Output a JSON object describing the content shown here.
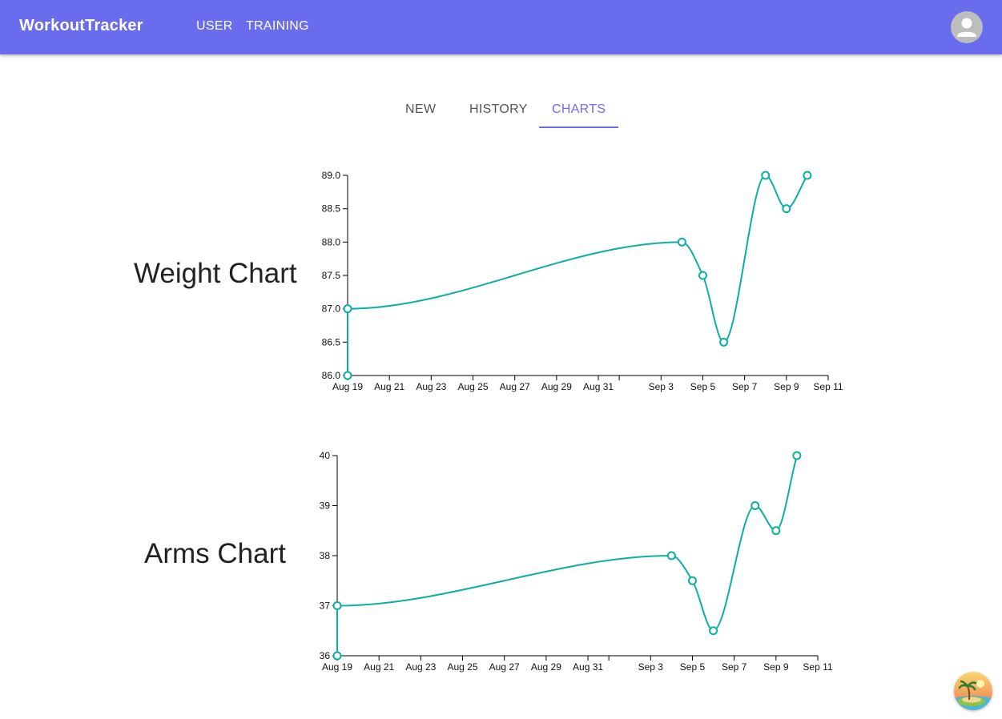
{
  "app": {
    "brand": "WorkoutTracker",
    "nav": {
      "user": "USER",
      "training": "TRAINING"
    }
  },
  "tabs": {
    "new": "NEW",
    "history": "HISTORY",
    "charts": "CHARTS",
    "active": "CHARTS"
  },
  "colors": {
    "appbar": "#6a6cee",
    "accent": "#6a6cee",
    "line": "#0aaea4"
  },
  "icons": {
    "avatar": "account-circle-icon",
    "fab": "tropical-island-logo-icon"
  },
  "charts": [
    {
      "title": "Weight Chart",
      "chart_data": {
        "type": "line",
        "curve": "smooth",
        "xlabel": "",
        "ylabel": "",
        "x_ticks": [
          "Aug 19",
          "Aug 21",
          "Aug 23",
          "Aug 25",
          "Aug 27",
          "Aug 29",
          "Aug 31",
          "",
          "Sep 3",
          "Sep 5",
          "Sep 7",
          "Sep 9",
          "Sep 11"
        ],
        "y_ticks": [
          "86.0",
          "86.5",
          "87.0",
          "87.5",
          "88.0",
          "88.5",
          "89.0"
        ],
        "xlim": [
          "2024-08-19",
          "2024-09-11"
        ],
        "ylim": [
          86.0,
          89.0
        ],
        "grid": false,
        "points": [
          {
            "x": "2024-08-19",
            "y": 86.0
          },
          {
            "x": "2024-08-19",
            "y": 87.0
          },
          {
            "x": "2024-09-04",
            "y": 88.0
          },
          {
            "x": "2024-09-05",
            "y": 87.5
          },
          {
            "x": "2024-09-06",
            "y": 86.5
          },
          {
            "x": "2024-09-08",
            "y": 89.0
          },
          {
            "x": "2024-09-09",
            "y": 88.5
          },
          {
            "x": "2024-09-10",
            "y": 89.0
          }
        ]
      }
    },
    {
      "title": "Arms Chart",
      "chart_data": {
        "type": "line",
        "curve": "smooth",
        "xlabel": "",
        "ylabel": "",
        "x_ticks": [
          "Aug 19",
          "Aug 21",
          "Aug 23",
          "Aug 25",
          "Aug 27",
          "Aug 29",
          "Aug 31",
          "",
          "Sep 3",
          "Sep 5",
          "Sep 7",
          "Sep 9",
          "Sep 11"
        ],
        "y_ticks": [
          "36",
          "37",
          "38",
          "39",
          "40"
        ],
        "xlim": [
          "2024-08-19",
          "2024-09-11"
        ],
        "ylim": [
          36,
          40
        ],
        "grid": false,
        "points": [
          {
            "x": "2024-08-19",
            "y": 36
          },
          {
            "x": "2024-08-19",
            "y": 37
          },
          {
            "x": "2024-09-04",
            "y": 38
          },
          {
            "x": "2024-09-05",
            "y": 37.5
          },
          {
            "x": "2024-09-06",
            "y": 36.5
          },
          {
            "x": "2024-09-08",
            "y": 39
          },
          {
            "x": "2024-09-09",
            "y": 38.5
          },
          {
            "x": "2024-09-10",
            "y": 40
          }
        ]
      }
    }
  ]
}
